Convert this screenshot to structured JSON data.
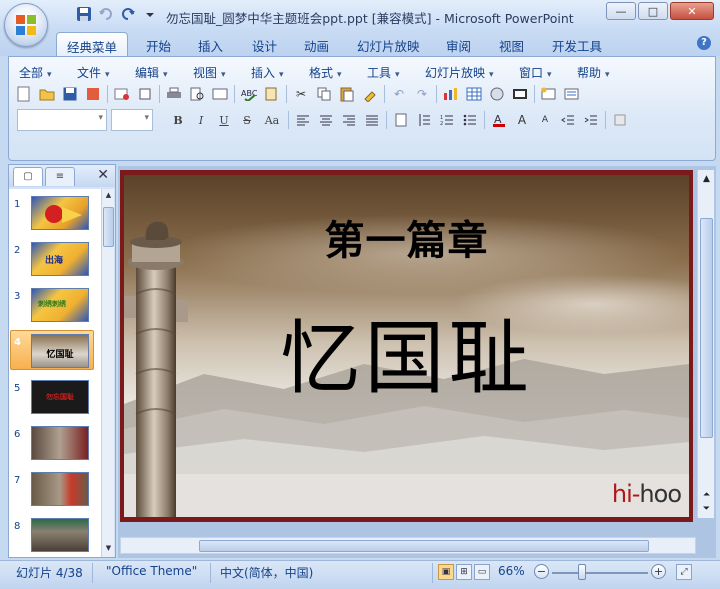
{
  "window": {
    "title": "勿忘国耻_圆梦中华主题班会ppt.ppt [兼容模式] - Microsoft PowerPoint",
    "controls": {
      "minimize": "—",
      "maximize": "□",
      "close": "✕"
    }
  },
  "ribbon_tabs": [
    {
      "label": "经典菜单",
      "active": true
    },
    {
      "label": "开始"
    },
    {
      "label": "插入"
    },
    {
      "label": "设计"
    },
    {
      "label": "动画"
    },
    {
      "label": "幻灯片放映"
    },
    {
      "label": "审阅"
    },
    {
      "label": "视图"
    },
    {
      "label": "开发工具"
    }
  ],
  "help_label": "?",
  "menus": [
    "全部",
    "文件",
    "编辑",
    "视图",
    "插入",
    "格式",
    "工具",
    "幻灯片放映",
    "窗口",
    "帮助"
  ],
  "format_buttons": {
    "bold": "B",
    "italic": "I",
    "underline": "U",
    "strike": "S",
    "case": "Aa"
  },
  "slides_panel": {
    "close": "✕",
    "slides": [
      {
        "number": "1",
        "label": ""
      },
      {
        "number": "2",
        "label": "出海"
      },
      {
        "number": "3",
        "label": "刺绣刺绣"
      },
      {
        "number": "4",
        "label": "忆国耻",
        "selected": true
      },
      {
        "number": "5",
        "label": "勿忘国耻"
      },
      {
        "number": "6",
        "label": ""
      },
      {
        "number": "7",
        "label": ""
      },
      {
        "number": "8",
        "label": ""
      }
    ]
  },
  "slide": {
    "title": "第一篇章",
    "heading": "忆国耻",
    "logo_a": "hi-",
    "logo_b": "hoo"
  },
  "status": {
    "slide_info": "幻灯片 4/38",
    "theme": "\"Office Theme\"",
    "language": "中文(简体，中国)",
    "zoom": "66%",
    "zoom_minus": "−",
    "zoom_plus": "+"
  }
}
